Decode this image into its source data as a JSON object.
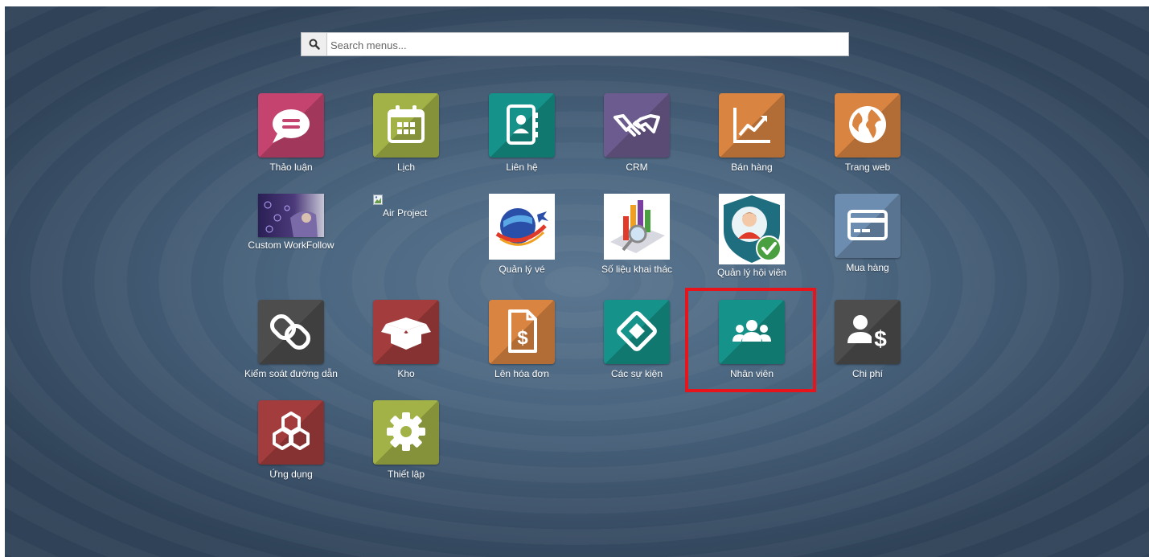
{
  "search": {
    "placeholder": "Search menus...",
    "icon": "search-icon"
  },
  "apps": {
    "thao_luan": {
      "label": "Thảo luận",
      "icon": "chat-bubble-icon",
      "color": "#c4436f"
    },
    "lich": {
      "label": "Lịch",
      "icon": "calendar-icon",
      "color": "#a3b246"
    },
    "lien_he": {
      "label": "Liên hệ",
      "icon": "address-book-icon",
      "color": "#159289"
    },
    "crm": {
      "label": "CRM",
      "icon": "handshake-icon",
      "color": "#6c5b8e"
    },
    "ban_hang": {
      "label": "Bán hàng",
      "icon": "line-chart-icon",
      "color": "#d98441"
    },
    "trang_web": {
      "label": "Trang web",
      "icon": "globe-icon",
      "color": "#d98441"
    },
    "custom_workfollow": {
      "label": "Custom WorkFollow",
      "icon": "workflow-image-icon"
    },
    "air_project": {
      "label": "Air Project",
      "icon": "broken-image-icon"
    },
    "quan_ly_ve": {
      "label": "Quản lý vé",
      "icon": "globe-plane-icon"
    },
    "so_lieu": {
      "label": "Số liệu khai thác",
      "icon": "bar-chart-magnifier-icon"
    },
    "quan_ly_hoi_vien": {
      "label": "Quản lý hội viên",
      "icon": "member-check-icon"
    },
    "mua_hang": {
      "label": "Mua hàng",
      "icon": "credit-card-icon",
      "color": "#6d8db0"
    },
    "kiem_soat": {
      "label": "Kiểm soát đường dẫn",
      "icon": "link-icon",
      "color": "#4d4d4d"
    },
    "kho": {
      "label": "Kho",
      "icon": "open-box-icon",
      "color": "#a33d3d"
    },
    "len_hoa_don": {
      "label": "Lên hóa đơn",
      "icon": "invoice-dollar-icon",
      "color": "#d98441"
    },
    "cac_su_kien": {
      "label": "Các sự kiện",
      "icon": "ticket-icon",
      "color": "#159289"
    },
    "nhan_vien": {
      "label": "Nhân viên",
      "icon": "users-icon",
      "color": "#159289"
    },
    "chi_phi": {
      "label": "Chi phí",
      "icon": "user-dollar-icon",
      "color": "#4d4d4d"
    },
    "ung_dung": {
      "label": "Ứng dụng",
      "icon": "cubes-icon",
      "color": "#a33d3d"
    },
    "thiet_lap": {
      "label": "Thiết lập",
      "icon": "gear-icon",
      "color": "#a3b246"
    }
  },
  "highlight_color": "#e8141c"
}
